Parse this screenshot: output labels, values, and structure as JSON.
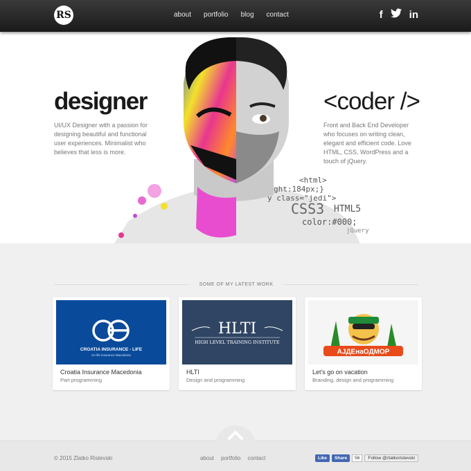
{
  "header": {
    "logo_text": "RS",
    "nav": [
      "about",
      "portfolio",
      "blog",
      "contact"
    ],
    "social": {
      "facebook_label": "f",
      "twitter_label": "🐦",
      "linkedin_label": "in"
    }
  },
  "hero": {
    "left_title": "designer",
    "left_text": "UI/UX Designer with a passion for designing beautiful and functional user experiences. Minimalist who believes that less is more.",
    "right_title": "<coder />",
    "right_text": "Front and Back End Developer who focuses on writing clean, elegant and efficient code. Love HTML, CSS, WordPress and a touch of jQuery.",
    "code_fragments": [
      "<html>",
      "ght:184px;}",
      "y class=\"jedi\">",
      "CSS3",
      "HTML5",
      "color:#000;",
      "jQuery"
    ]
  },
  "work": {
    "title": "SOME OF MY LATEST WORK",
    "items": [
      {
        "title": "Croatia Insurance Macedonia",
        "subtitle": "Part programming",
        "thumb_brand": "CROATIA INSURANCE - LIFE",
        "thumb_sub": "SA life insurance Macedonia",
        "color": "#0a4a9a"
      },
      {
        "title": "HLTI",
        "subtitle": "Design and programming",
        "thumb_brand": "HLTI",
        "thumb_sub": "HIGH LEVEL TRAINING INSTITUTE",
        "color": "#2f4563"
      },
      {
        "title": "Let's go on vacation",
        "subtitle": "Branding, design and programming",
        "thumb_brand": "АЈДЕнаОДМОР",
        "thumb_sub": "",
        "color": "#f5f5f5"
      }
    ]
  },
  "footer": {
    "copyright": "© 2015 Zlatko Ristevski",
    "nav": [
      "about",
      "portfolio",
      "contact"
    ],
    "like_label": "Like",
    "share_label": "Share",
    "share_count": "56",
    "follow_label": "Follow @zlatkoristevski"
  }
}
